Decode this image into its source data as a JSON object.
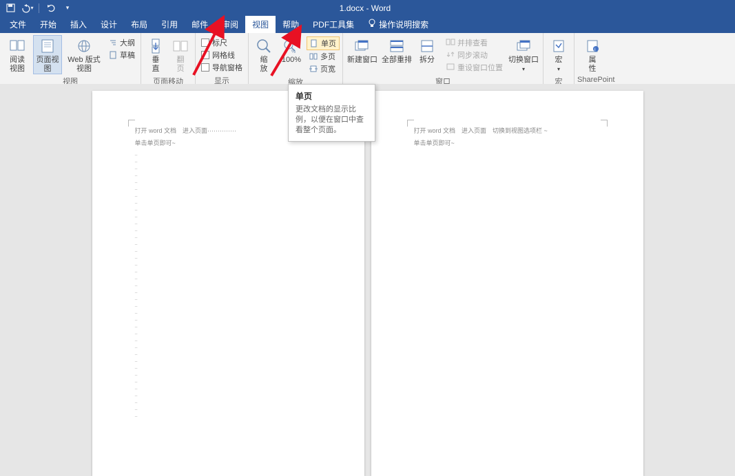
{
  "title": "1.docx  -  Word",
  "tabs": {
    "file": "文件",
    "home": "开始",
    "insert": "插入",
    "design": "设计",
    "layout": "布局",
    "ref": "引用",
    "mail": "邮件",
    "review": "审阅",
    "view": "视图",
    "help": "帮助",
    "pdf": "PDF工具集",
    "tell": "操作说明搜索"
  },
  "views": {
    "read": "阅读\n视图",
    "print": "页面视图",
    "web": "Web 版式视图",
    "outline": "大纲",
    "draft": "草稿",
    "group": "视图"
  },
  "pagemove": {
    "vertical": "垂\n直",
    "sbs": "翻\n页",
    "group": "页面移动"
  },
  "show": {
    "ruler": "标尺",
    "grid": "网格线",
    "nav": "导航窗格",
    "group": "显示"
  },
  "zoom": {
    "zoom": "缩\n放",
    "hundred": "100%",
    "one": "单页",
    "multi": "多页",
    "width": "页宽",
    "group": "缩放"
  },
  "window": {
    "new": "新建窗口",
    "all": "全部重排",
    "split": "拆分",
    "side": "并排查看",
    "sync": "同步滚动",
    "reset": "重设窗口位置",
    "switch": "切换窗口",
    "group": "窗口"
  },
  "macros": {
    "macro": "宏",
    "group": "宏"
  },
  "sharepoint": {
    "prop": "属\n性",
    "group": "SharePoint"
  },
  "tooltip": {
    "title": "单页",
    "body": "更改文档的显示比例，以便在窗口中查看整个页面。"
  },
  "doc": {
    "p1_header": "打开 word 文档　进入页面",
    "p1_header2": "··············",
    "p1_line2": "单击单页即可~",
    "p2_header": "打开 word 文档　进入页面　切换到视图选项栏",
    "p2_line2": "单击单页即可~"
  }
}
